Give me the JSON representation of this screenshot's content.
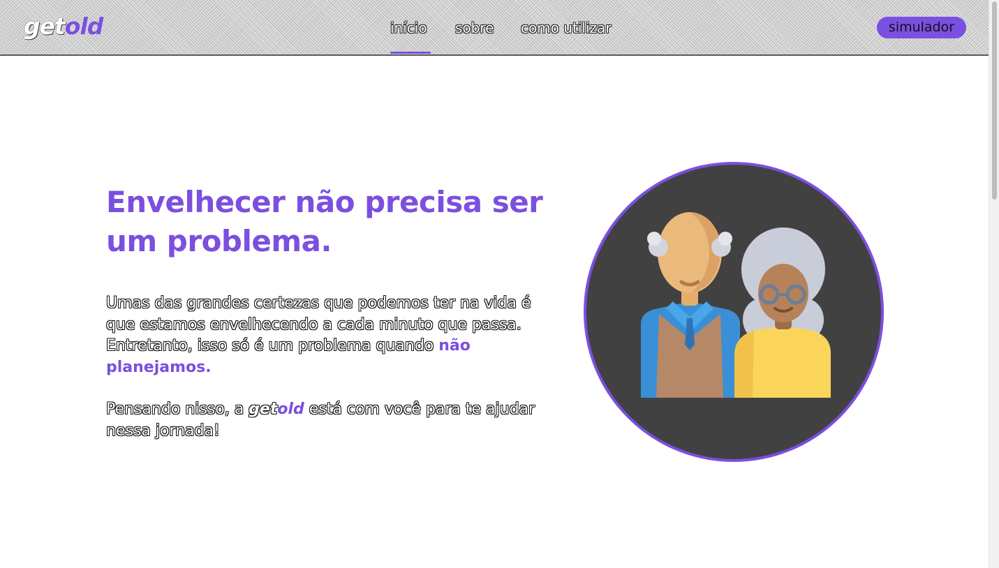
{
  "header": {
    "logo": {
      "part1": "get",
      "part2": "old"
    },
    "nav": [
      {
        "label": "início"
      },
      {
        "label": "sobre"
      },
      {
        "label": "como utilizar"
      }
    ],
    "cta_label": "simulador"
  },
  "hero": {
    "title": "Envelhecer não precisa ser um problema.",
    "paragraph1": {
      "text": "Umas das grandes certezas que podemos ter na vida é que estamos envelhecendo a cada minuto que passa. Entretanto, isso só é um problema quando ",
      "highlight": "não planejamos."
    },
    "paragraph2": {
      "before": "Pensando nisso, a ",
      "brand_part1": "get",
      "brand_part2": "old",
      "after": " está com você para te ajudar nessa jornada!"
    }
  },
  "illustration": {
    "icon": "elderly-couple-icon"
  },
  "colors": {
    "accent": "#7b4fe0",
    "circle_background": "#414141",
    "text": "#ffffff"
  }
}
